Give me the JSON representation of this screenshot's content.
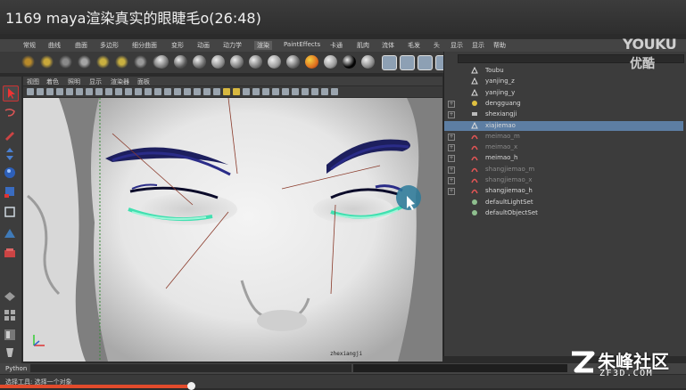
{
  "window": {
    "title": "1169 maya渲染真实的眼睫毛o(26:48)"
  },
  "menubar": {
    "items": [
      "常规",
      "曲线",
      "曲面",
      "多边形",
      "细分曲面",
      "变形",
      "动画",
      "动力学",
      "渲染",
      "PaintEffects",
      "卡通",
      "肌肉",
      "流体",
      "毛发",
      "头"
    ],
    "active_index": 8
  },
  "viewport_menu": {
    "items": [
      "视图",
      "着色",
      "照明",
      "显示",
      "渲染器",
      "面板"
    ]
  },
  "viewport": {
    "camera_label": "zhexiangji"
  },
  "outliner": {
    "menu": [
      "显示",
      "显示",
      "帮助"
    ],
    "items": [
      {
        "label": "Toubu",
        "type": "mesh",
        "expandable": false,
        "dim": false,
        "selected": false
      },
      {
        "label": "yanjing_z",
        "type": "mesh",
        "expandable": false,
        "dim": false,
        "selected": false
      },
      {
        "label": "yanjing_y",
        "type": "mesh",
        "expandable": false,
        "dim": false,
        "selected": false
      },
      {
        "label": "dengguang",
        "type": "light",
        "expandable": true,
        "dim": false,
        "selected": false
      },
      {
        "label": "shexiangji",
        "type": "camera",
        "expandable": true,
        "dim": false,
        "selected": false
      },
      {
        "label": "xiajiemao",
        "type": "mesh",
        "expandable": false,
        "dim": false,
        "selected": true
      },
      {
        "label": "meimao_m",
        "type": "curve",
        "expandable": true,
        "dim": true,
        "selected": false
      },
      {
        "label": "meimao_x",
        "type": "curve",
        "expandable": true,
        "dim": true,
        "selected": false
      },
      {
        "label": "meimao_h",
        "type": "curve",
        "expandable": true,
        "dim": false,
        "selected": false
      },
      {
        "label": "shangjiemao_m",
        "type": "curve",
        "expandable": true,
        "dim": true,
        "selected": false
      },
      {
        "label": "shangjiemao_x",
        "type": "curve",
        "expandable": true,
        "dim": true,
        "selected": false
      },
      {
        "label": "shangjiemao_h",
        "type": "curve",
        "expandable": true,
        "dim": false,
        "selected": false
      },
      {
        "label": "defaultLightSet",
        "type": "set",
        "expandable": false,
        "dim": false,
        "selected": false
      },
      {
        "label": "defaultObjectSet",
        "type": "set",
        "expandable": false,
        "dim": false,
        "selected": false
      }
    ]
  },
  "command_line": {
    "label": "Python"
  },
  "help_line": {
    "text": "选择工具: 选择一个对象"
  },
  "video": {
    "progress_fraction": 0.28
  },
  "watermarks": {
    "youku_en": "YOUKU",
    "youku_cn": "优酷",
    "site_cn": "朱峰社区",
    "site_en": "ZF3D.COM"
  },
  "colors": {
    "accent": "#5d7ea3",
    "progress": "#e24b2c",
    "lash": "#40e0b0",
    "brow": "#1d1f5e"
  }
}
